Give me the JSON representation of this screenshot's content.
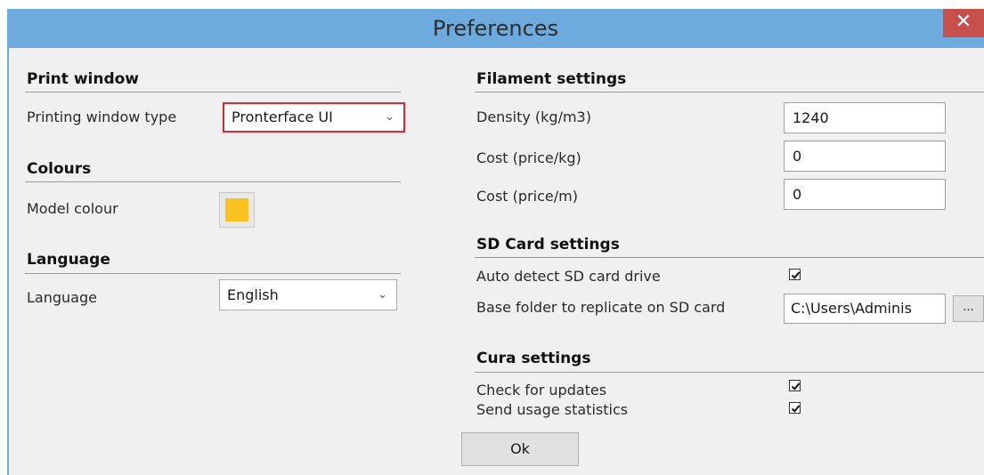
{
  "window": {
    "title": "Preferences",
    "close_icon": "close-icon"
  },
  "colors": {
    "titlebar": "#6dabde",
    "close": "#c7504d",
    "model_colour": "#f9c21e",
    "highlight": "#e0252f"
  },
  "left": {
    "print_window": {
      "heading": "Print window",
      "type_label": "Printing window type",
      "type_value": "Pronterface UI"
    },
    "colours": {
      "heading": "Colours",
      "model_label": "Model colour"
    },
    "language": {
      "heading": "Language",
      "label": "Language",
      "value": "English"
    }
  },
  "right": {
    "filament": {
      "heading": "Filament settings",
      "density_label": "Density (kg/m3)",
      "density_value": "1240",
      "cost_kg_label": "Cost (price/kg)",
      "cost_kg_value": "0",
      "cost_m_label": "Cost (price/m)",
      "cost_m_value": "0"
    },
    "sd_card": {
      "heading": "SD Card settings",
      "auto_detect_label": "Auto detect SD card drive",
      "auto_detect_checked": true,
      "base_folder_label": "Base folder to replicate on SD card",
      "base_folder_value": "C:\\Users\\Adminis",
      "browse_label": "..."
    },
    "cura": {
      "heading": "Cura settings",
      "updates_label": "Check for updates",
      "updates_checked": true,
      "stats_label": "Send usage statistics",
      "stats_checked": true
    }
  },
  "footer": {
    "ok_label": "Ok"
  }
}
